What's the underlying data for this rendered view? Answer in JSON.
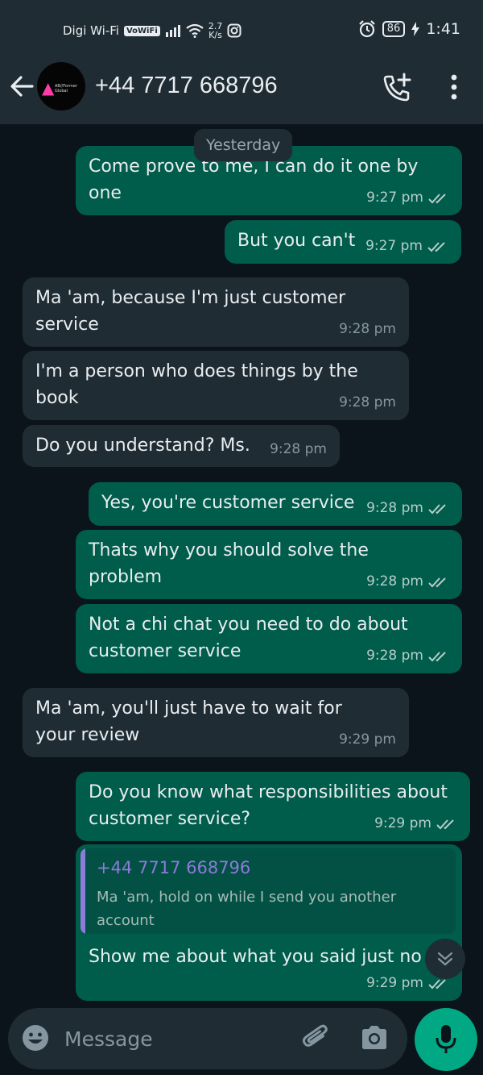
{
  "status_bar": {
    "carrier": "Digi Wi-Fi",
    "volte_badge": "VoWiFi",
    "net_speed_value": "2.7",
    "net_speed_unit": "K/s",
    "battery": "86",
    "time": "1:41"
  },
  "header": {
    "contact": "+44 7717 668796",
    "avatar_text": "AB//Former Global",
    "icons": [
      "back-arrow-icon",
      "add-call-icon",
      "more-vert-icon"
    ]
  },
  "chat": {
    "date_label": "Yesterday",
    "messages": [
      {
        "direction": "out",
        "text": "Come prove to me, I can do it one by one",
        "time": "9:27 pm"
      },
      {
        "direction": "out",
        "text": "But you can't",
        "time": "9:27 pm"
      },
      {
        "direction": "in",
        "text": "Ma 'am, because I'm just customer service",
        "time": "9:28 pm"
      },
      {
        "direction": "in",
        "text": "I'm a person who does things by the book",
        "time": "9:28 pm"
      },
      {
        "direction": "in",
        "text": "Do you understand? Ms.",
        "time": "9:28 pm"
      },
      {
        "direction": "out",
        "text": "Yes, you're customer service",
        "time": "9:28 pm"
      },
      {
        "direction": "out",
        "text": "Thats why you should solve  the problem",
        "time": "9:28 pm"
      },
      {
        "direction": "out",
        "text": "Not a chi chat you need to do about customer service",
        "time": "9:28 pm"
      },
      {
        "direction": "in",
        "text": "Ma 'am, you'll just have to wait for your review",
        "time": "9:29 pm"
      },
      {
        "direction": "out",
        "text": "Do you know what responsibilities about customer service?",
        "time": "9:29 pm"
      },
      {
        "direction": "out",
        "text": "Show me about what you said just no",
        "time": "9:29 pm",
        "quoted": {
          "sender": "+44 7717 668796",
          "text": "Ma 'am, hold on while I send you another account"
        }
      }
    ]
  },
  "composer": {
    "placeholder": "Message",
    "icons": [
      "emoji-icon",
      "attach-icon",
      "camera-icon",
      "mic-icon"
    ]
  },
  "colors": {
    "outgoing_bubble": "#005c4b",
    "incoming_bubble": "#1f2c34",
    "background": "#0b141a",
    "accent": "#00a884",
    "quote_accent": "#8c7bd8"
  }
}
